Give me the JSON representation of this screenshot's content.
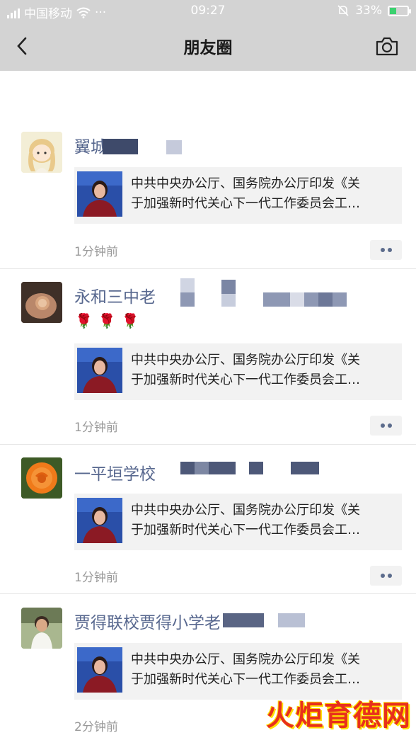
{
  "status_bar": {
    "carrier": "中国移动",
    "dots": "···",
    "time": "09:27",
    "battery": "33%",
    "battery_level": 0.33
  },
  "navbar": {
    "title": "朋友圈"
  },
  "posts": [
    {
      "name": "翼城",
      "card_line1": "中共中央办公厅、国务院办公厅印发《关",
      "card_line2": "于加强新时代关心下一代工作委员会工…",
      "time": "1分钟前"
    },
    {
      "name": "永和三中老",
      "emoji": "🌹🌹🌹",
      "card_line1": "中共中央办公厅、国务院办公厅印发《关",
      "card_line2": "于加强新时代关心下一代工作委员会工…",
      "time": "1分钟前"
    },
    {
      "name": "一平垣学校",
      "card_line1": "中共中央办公厅、国务院办公厅印发《关",
      "card_line2": "于加强新时代关心下一代工作委员会工…",
      "time": "1分钟前"
    },
    {
      "name": "贾得联校贾得小学老",
      "card_line1": "中共中央办公厅、国务院办公厅印发《关",
      "card_line2": "于加强新时代关心下一代工作委员会工…",
      "time": "2分钟前"
    }
  ],
  "watermark": "火炬育德网"
}
